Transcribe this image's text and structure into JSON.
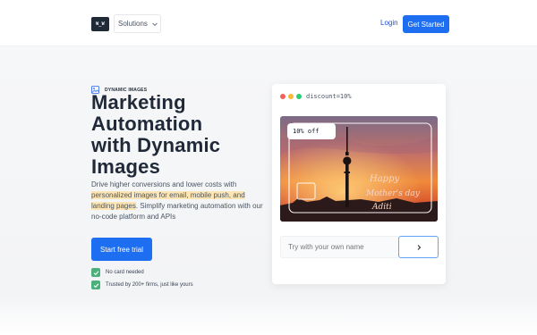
{
  "header": {
    "logo_text": "W_W",
    "solutions_label": "Solutions",
    "login_label": "Login",
    "get_started_label": "Get Started"
  },
  "hero": {
    "eyebrow": "DYNAMIC IMAGES",
    "headline_lines": [
      "Marketing",
      "Automation",
      "with Dynamic",
      "Images"
    ],
    "subcopy": {
      "part1": "Drive higher conversions and lower costs with",
      "highlight1": "personalized images for email, mobile push, and",
      "highlight2": "landing pages",
      "part2": ". Simplify marketing automation with our no-code platform and APIs"
    },
    "cta_label": "Start free trial",
    "checks": [
      "No card needed",
      "Trusted by 200+ firms, just like yours"
    ]
  },
  "demo_card": {
    "url_label": "discount=10%",
    "discount_tag": "10% off",
    "greeting_line1": "Happy",
    "greeting_line2": "Mother's day",
    "greeting_name": "Aditi",
    "input_placeholder": "Try with your own name",
    "submit_icon": "chevron-right-icon"
  },
  "colors": {
    "primary": "#1d6ef0",
    "text_dark": "#1f2937",
    "highlight": "#fde6b3",
    "check_green": "#4caf7c",
    "dot_red": "#f2625d",
    "dot_yellow": "#f6b93b",
    "dot_green": "#2ecc71"
  }
}
